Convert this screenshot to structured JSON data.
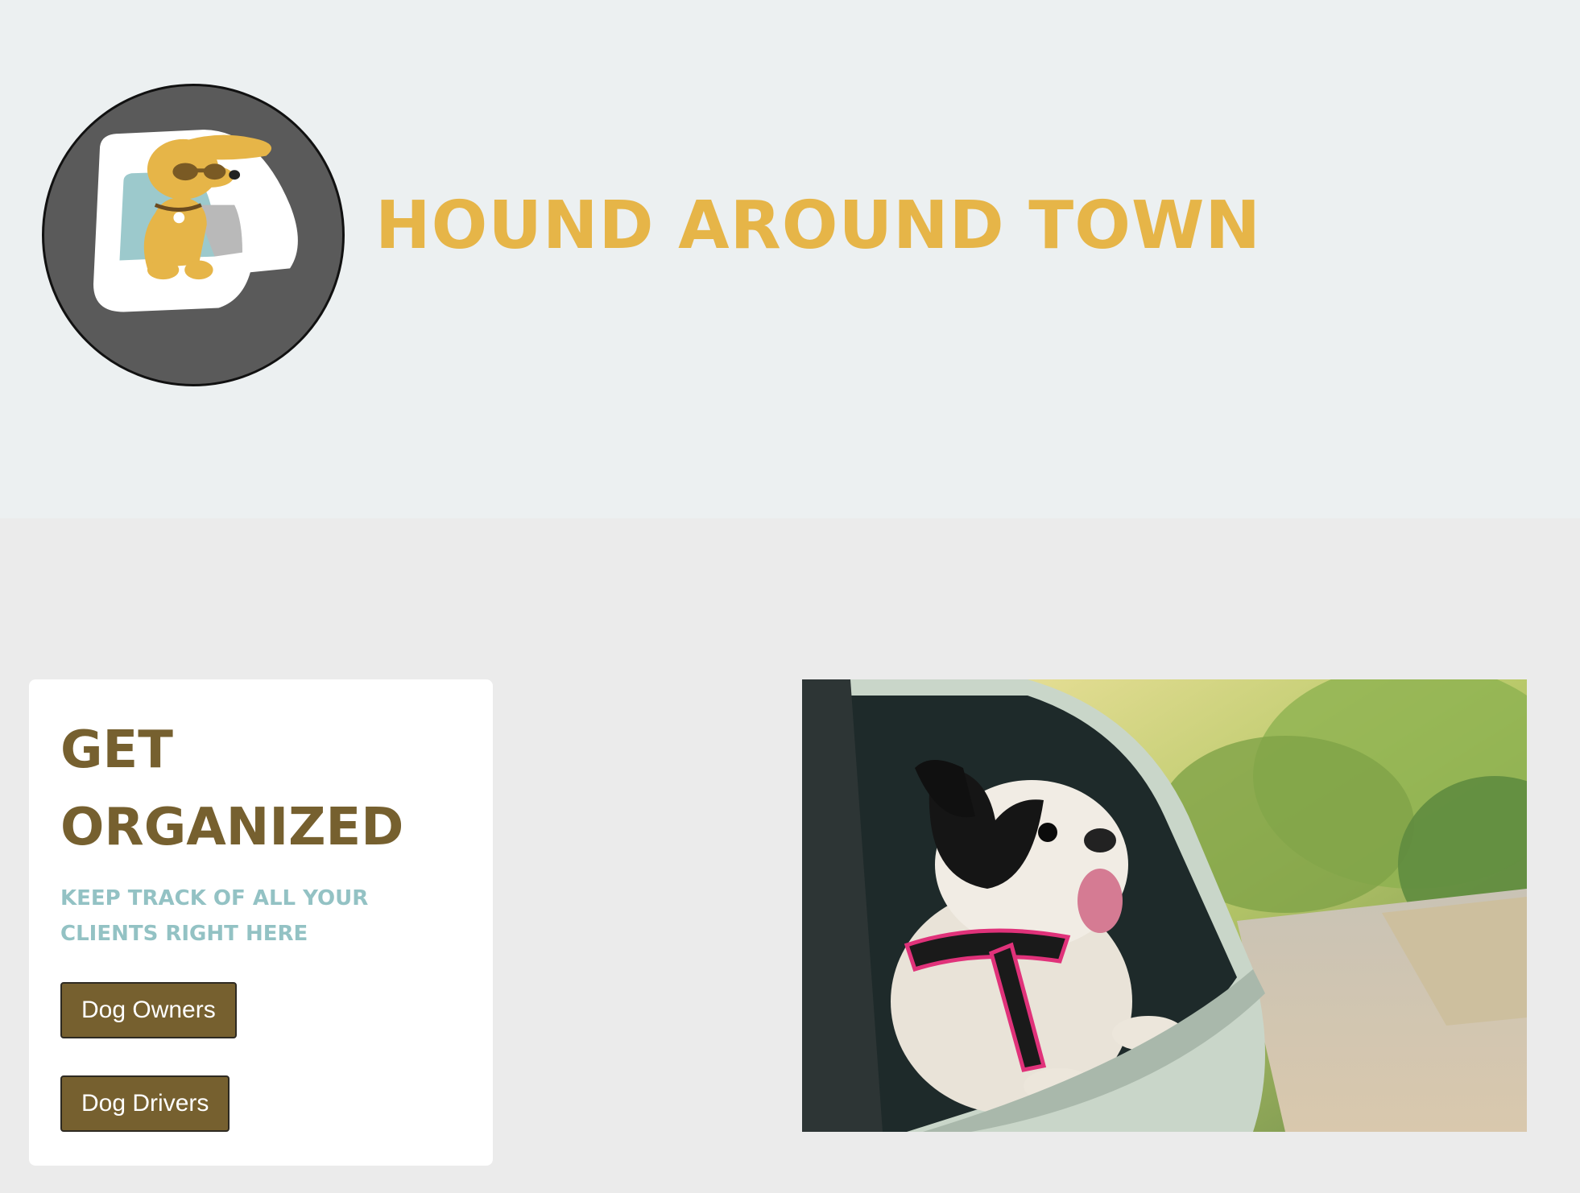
{
  "header": {
    "brand_title": "Hound Around Town",
    "logo_icon": "dog-in-car-window-logo"
  },
  "card": {
    "title": "Get Organized",
    "subtitle": "Keep track of all your clients right here",
    "buttons": [
      {
        "label": "Dog Owners"
      },
      {
        "label": "Dog Drivers"
      }
    ]
  },
  "hero_image": {
    "subject": "dog-looking-out-car-window-photo"
  },
  "colors": {
    "header_bg": "#ecf0f1",
    "page_bg": "#ebebeb",
    "brand_gold": "#e6b548",
    "button_brown": "#76602f",
    "subtitle_teal": "#93c2c4"
  }
}
